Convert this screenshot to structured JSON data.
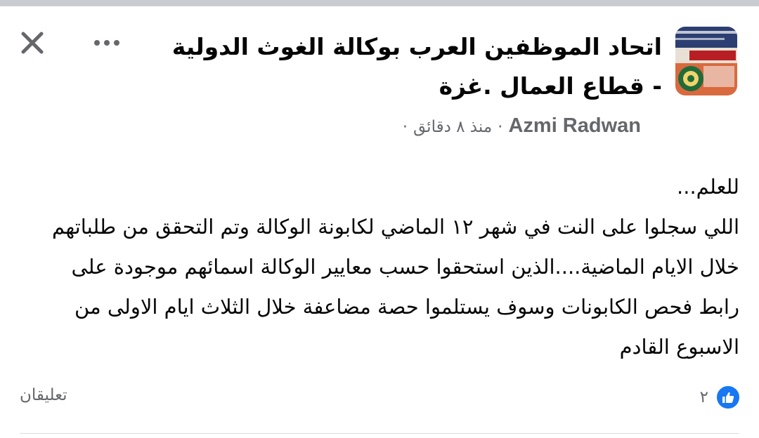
{
  "header": {
    "group_name": "اتحاد الموظفين العرب بوكالة الغوث الدولية - قطاع العمال .غزة",
    "author": "Azmi Radwan",
    "time": "منذ ٨ دقائق",
    "separator": "·",
    "icons": {
      "close": "close-icon",
      "more": "more-options-icon",
      "avatar": "group-avatar"
    }
  },
  "post": {
    "lines": [
      "للعلم...",
      "اللي سجلوا على النت في شهر ١٢ الماضي لكابونة الوكالة وتم التحقق من طلباتهم خلال الايام الماضية....الذين استحقوا حسب معايير الوكالة اسمائهم موجودة على رابط فحص الكابونات وسوف يستلموا حصة مضاعفة خلال الثلاث ايام الاولى من الاسبوع القادم"
    ]
  },
  "footer": {
    "reaction_count": "٢",
    "comments_label": "تعليقان",
    "like_icon": "like-icon"
  },
  "colors": {
    "accent": "#1877f2",
    "secondary_text": "#65676b",
    "primary_text": "#050505",
    "top_strip": "#c9ccd1"
  }
}
